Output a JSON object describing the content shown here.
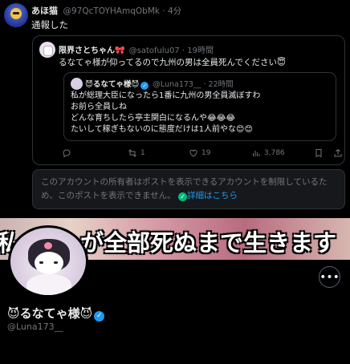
{
  "top_post": {
    "author_name": "あほ猫",
    "meta": "@97QcTOYHAmqObMk · 4分",
    "text": "通報した"
  },
  "quote1": {
    "author_name": "限界さとちゃん🎀",
    "meta": "@satofulu07 · 19時間",
    "text": "るなてゃ様が仰ってるので九州の男は全員死んでください😇"
  },
  "quote2": {
    "author_name": "😈るなてゃ様😈",
    "meta": "@Luna173__ · 22時間",
    "lines": [
      "私が総理大臣になったら1番に九州の男全員滅ぼすわ",
      "お前ら全員しね",
      "どんな育ちしたら亭主関白になるんや😂😂😂",
      "たいして稼ぎもないのに態度だけは1人前やな😊😊"
    ]
  },
  "actions": {
    "reply": "",
    "repost": "1",
    "like": "19",
    "views": "3,786"
  },
  "restricted_notice": {
    "text": "このアカウントの所有者はポストを表示できるアカウントを制限しているため、このポストを表示できません。",
    "link": "詳細はこちら"
  },
  "banner": {
    "text": "が全部死ぬまで生きます",
    "text_left": "私"
  },
  "profile": {
    "display_name": "😈るなてゃ様😈",
    "handle": "@Luna173__"
  },
  "icons": {
    "more": "more-icon",
    "verified": "verified-badge-icon"
  }
}
